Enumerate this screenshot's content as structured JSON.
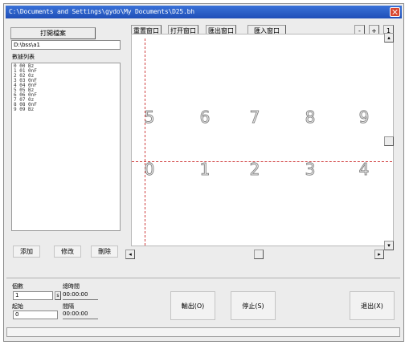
{
  "window": {
    "title": "C:\\Documents and Settings\\gydo\\My Documents\\D25.bh"
  },
  "top_left": {
    "open_file_button": "打開檔案",
    "path_value": "D:\\bss\\a1"
  },
  "list": {
    "header": "數據列表",
    "items": [
      "0  00  Bz",
      "1  01  0nF",
      "2  02  0z",
      "3  03  0nF",
      "4  04  0nF",
      "5  05  Bz",
      "6  06  0nF",
      "7  07  0z",
      "8  08  0nF",
      "9  09  Bz"
    ]
  },
  "list_buttons": {
    "add": "添加",
    "modify": "修改",
    "delete": "刪除"
  },
  "toolbar": {
    "buttons": [
      "重置窗口",
      "打开窗口",
      "匯出窗口",
      "匯入窗口"
    ],
    "right_buttons": [
      "-",
      "+",
      "1"
    ]
  },
  "canvas": {
    "digits_top": [
      "5",
      "6",
      "7",
      "8",
      "9"
    ],
    "digits_bottom": [
      "0",
      "1",
      "2",
      "3",
      "4"
    ]
  },
  "scroll": {
    "left_arrow": "◂",
    "right_arrow": "▸"
  },
  "bottom": {
    "count_label": "個數",
    "count_value": "1",
    "count_btn": "s",
    "start_label": "起始",
    "start_value": "0",
    "total_time_label": "總時間",
    "total_time_value": "00:00:00",
    "interval_label": "間隔",
    "interval_value": "00:00:00",
    "output_button": "輸出(O)",
    "stop_button": "停止(S)",
    "exit_button": "退出(X)"
  }
}
